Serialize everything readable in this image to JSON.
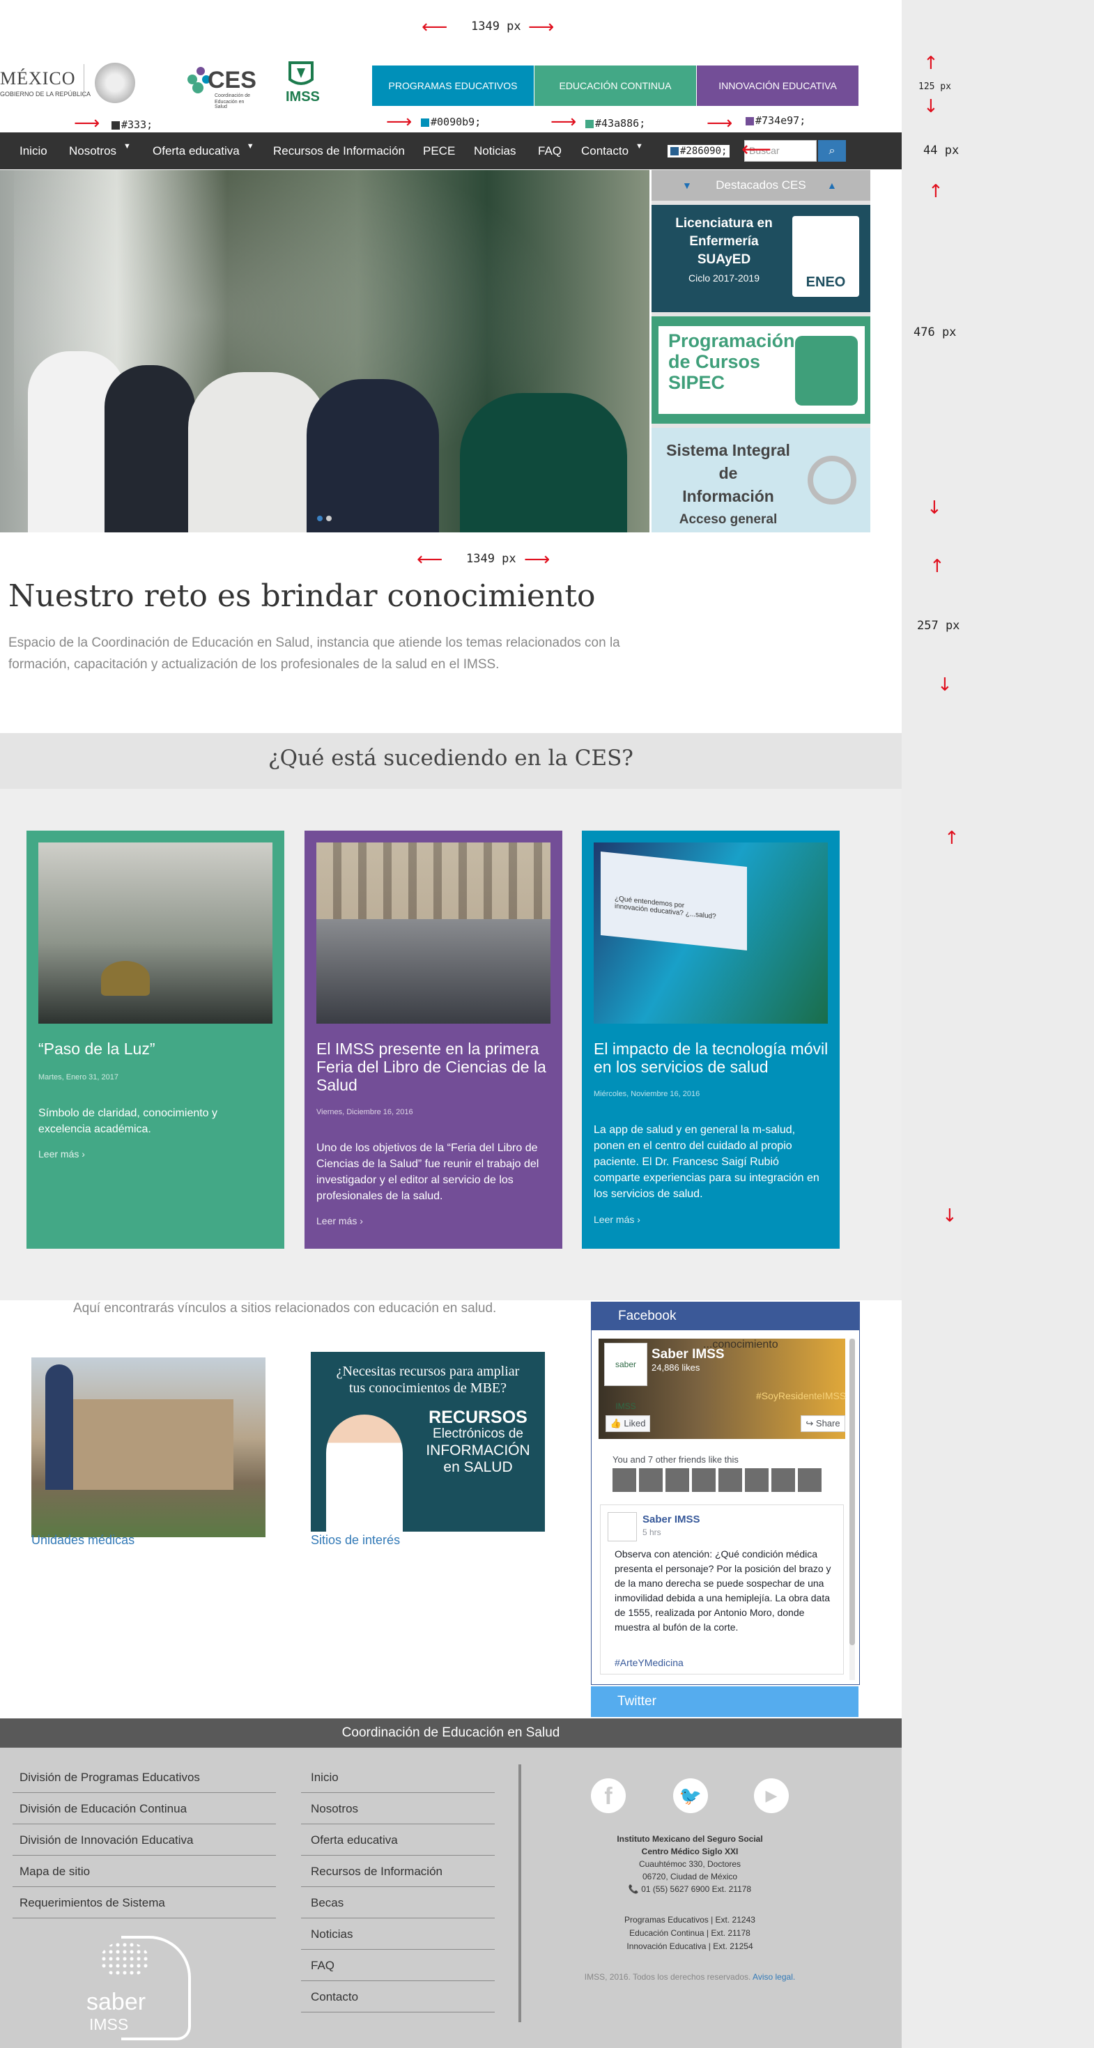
{
  "annotations": {
    "width_top": "1349 px",
    "width_mid": "1349 px",
    "h_header": "125 px",
    "h_nav": "44 px",
    "h_hero": "476 px",
    "h_intro": "257 px",
    "color_nav": "#333;",
    "color_blue": "#0090b9;",
    "color_green": "#43a886;",
    "color_purple": "#734e97;",
    "color_search": "#286090;"
  },
  "colors": {
    "blue": "#0090b9",
    "green": "#43a886",
    "purple": "#734e97",
    "nav": "#333333",
    "search": "#286090"
  },
  "header": {
    "mexico": "MÉXICO",
    "gobierno": "GOBIERNO DE LA REPÚBLICA",
    "ces": "CES",
    "ces_sub1": "Coordinación de",
    "ces_sub2": "Educación en Salud",
    "imss": "IMSS",
    "buttons": [
      "PROGRAMAS EDUCATIVOS",
      "EDUCACIÓN CONTINUA",
      "INNOVACIÓN EDUCATIVA"
    ]
  },
  "nav": {
    "items": [
      "Inicio",
      "Nosotros",
      "Oferta educativa",
      "Recursos de Información",
      "PECE",
      "Noticias",
      "FAQ",
      "Contacto"
    ],
    "search_placeholder": "Buscar"
  },
  "destacados": {
    "title": "Destacados CES",
    "card1": [
      "Licenciatura en",
      "Enfermería",
      "SUAyED",
      "Ciclo 2017-2019"
    ],
    "card1_logo": "ENEO",
    "card2": [
      "Programación",
      "de Cursos",
      "SIPEC"
    ],
    "card3": [
      "Sistema Integral de",
      "Información",
      "Acceso general"
    ]
  },
  "intro": {
    "title": "Nuestro reto es brindar conocimiento",
    "text": "Espacio de la Coordinación de Educación en Salud, instancia que atiende los temas relacionados con la formación, capacitación y actualización de los profesionales de la salud en el IMSS."
  },
  "news": {
    "heading": "¿Qué está sucediendo en la CES?",
    "items": [
      {
        "title": "“Paso de la Luz”",
        "date": "Martes, Enero 31, 2017",
        "body": "Símbolo de claridad, conocimiento y excelencia académica.",
        "more": "Leer más ›"
      },
      {
        "title": "El IMSS presente en la primera Feria del Libro de Ciencias de la Salud",
        "date": "Viernes, Diciembre 16, 2016",
        "body": "Uno de los objetivos de la “Feria del Libro de Ciencias de la Salud” fue reunir el trabajo del investigador y el editor al servicio de los profesionales de la salud.",
        "more": "Leer más ›"
      },
      {
        "title": "El impacto de la tecnología móvil en los servicios de salud",
        "date": "Miércoles, Noviembre 16, 2016",
        "body": "La app de salud y en general la m-salud, ponen en el centro del cuidado al propio paciente. El Dr. Francesc Saigí Rubió comparte experiencias para su integración en los servicios de salud.",
        "more": "Leer más ›"
      }
    ],
    "screen_text": "¿Qué entendemos por innovación educativa? ¿...salud?"
  },
  "links": {
    "intro": "Aquí encontrarás vínculos a sitios relacionados con educación en salud.",
    "unidades": "Unidades médicas",
    "sitios": "Sitios de interés",
    "banner": [
      "¿Necesitas recursos para ampliar",
      "tus conocimientos de MBE?",
      "RECURSOS",
      "Electrónicos de",
      "INFORMACIÓN",
      "en SALUD"
    ]
  },
  "facebook": {
    "header": "Facebook",
    "page": "Saber IMSS",
    "likes": "24,886 likes",
    "cover_text": "...conocimiento",
    "hashtag_cover": "#SoyResidenteIMSS",
    "liked": "Liked",
    "share": "Share",
    "friends": "You and 7 other friends like this",
    "post_author": "Saber IMSS",
    "post_time": "5 hrs",
    "post": "Observa con atención: ¿Qué condición médica presenta el personaje? Por la posición del brazo y de la mano derecha se puede sospechar de una inmovilidad debida a una hemiplejía. La obra data de 1555, realizada por Antonio Moro, donde muestra al bufón de la corte.",
    "post_tag": "#ArteYMedicina",
    "avatar": "saber IMSS"
  },
  "twitter": {
    "label": "Twitter"
  },
  "footer": {
    "title": "Coordinación de Educación en Salud",
    "col1": [
      "División de Programas Educativos",
      "División de Educación Continua",
      "División de Innovación Educativa",
      "Mapa de sitio",
      "Requerimientos de Sistema"
    ],
    "col2": [
      "Inicio",
      "Nosotros",
      "Oferta educativa",
      "Recursos de Información",
      "Becas",
      "Noticias",
      "FAQ",
      "Contacto"
    ],
    "logo": [
      "saber",
      "IMSS"
    ],
    "address": [
      "Instituto Mexicano del Seguro Social",
      "Centro Médico Siglo XXI",
      "Cuauhtémoc 330, Doctores",
      "06720, Ciudad de México"
    ],
    "phone": "01 (55) 5627 6900   Ext.   21178",
    "exts": [
      "Programas Educativos |  Ext. 21243",
      "Educación Continua |  Ext. 21178",
      "Innovación Educativa |  Ext. 21254"
    ],
    "copyright": "IMSS, 2016. Todos los derechos reservados.",
    "aviso": "Aviso legal."
  }
}
